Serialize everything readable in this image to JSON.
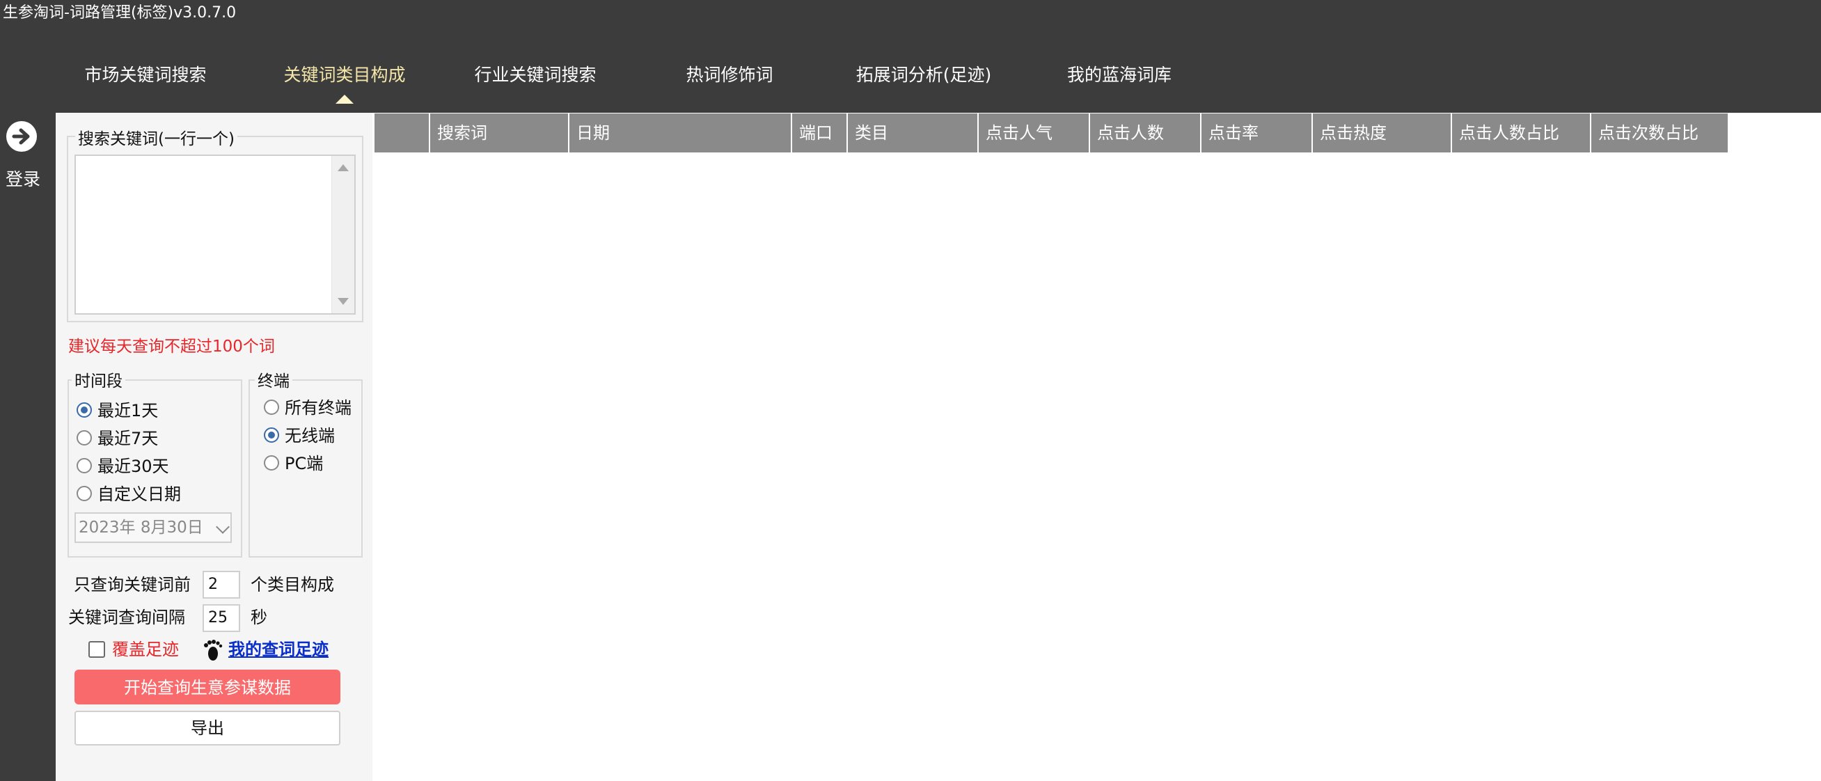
{
  "app": {
    "title": "生参淘词-词路管理(标签)v3.0.7.0"
  },
  "nav": {
    "tabs": [
      {
        "label": "市场关键词搜索",
        "active": false
      },
      {
        "label": "关键词类目构成",
        "active": true
      },
      {
        "label": "行业关键词搜索",
        "active": false
      },
      {
        "label": "热词修饰词",
        "active": false
      },
      {
        "label": "拓展词分析(足迹)",
        "active": false
      },
      {
        "label": "我的蓝海词库",
        "active": false
      }
    ]
  },
  "sidebar": {
    "login_label": "登录",
    "login_icon": "arrow-right-circle-icon"
  },
  "search": {
    "group_title": "搜索关键词(一行一个)",
    "keywords_value": "",
    "warning": "建议每天查询不超过100个词"
  },
  "time_period": {
    "title": "时间段",
    "options": [
      {
        "label": "最近1天",
        "checked": true
      },
      {
        "label": "最近7天",
        "checked": false
      },
      {
        "label": "最近30天",
        "checked": false
      },
      {
        "label": "自定义日期",
        "checked": false
      }
    ],
    "date_value": "2023年  8月30日"
  },
  "terminal": {
    "title": "终端",
    "options": [
      {
        "label": "所有终端",
        "checked": false
      },
      {
        "label": "无线端",
        "checked": true
      },
      {
        "label": "PC端",
        "checked": false
      }
    ]
  },
  "settings": {
    "top_n_prefix": "只查询关键词前",
    "top_n_value": "2",
    "top_n_suffix": "个类目构成",
    "interval_label": "关键词查询间隔",
    "interval_value": "25",
    "interval_unit": "秒"
  },
  "footprint": {
    "overwrite_label": "覆盖足迹",
    "overwrite_checked": false,
    "link_label": "我的查词足迹",
    "icon": "footprint-icon"
  },
  "actions": {
    "start_label": "开始查询生意参谋数据",
    "export_label": "导出"
  },
  "colors": {
    "topbar": "#3c3c3c",
    "active_tab": "#f3e6a8",
    "warning": "#e8262a",
    "start_button": "#f96a6c",
    "link": "#0a2fc9",
    "table_header": "#8a8a8a"
  },
  "table": {
    "columns": [
      "",
      "搜索词",
      "日期",
      "端口",
      "类目",
      "点击人气",
      "点击人数",
      "点击率",
      "点击热度",
      "点击人数占比",
      "点击次数占比"
    ],
    "rows": []
  }
}
